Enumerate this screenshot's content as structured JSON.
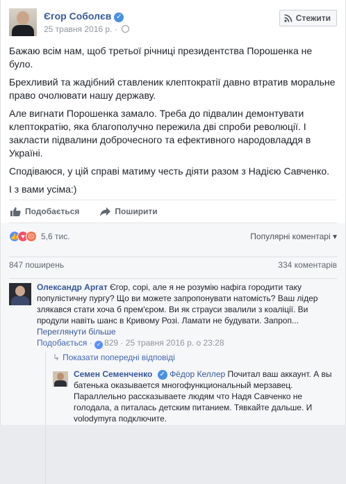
{
  "post": {
    "author": "Єгор Соболєв",
    "verified_mark": "✓",
    "date": "25 травня 2016 р.",
    "follow_label": "Стежити",
    "paragraphs": [
      "Бажаю всім нам, щоб третьої річниці президентства Порошенка не було.",
      "Брехливий та жадібний ставленик клептократії давно втратив моральне право очолювати нашу державу.",
      "Але вигнати Порошенка замало. Треба до підвалин демонтувати клептократію, яка благополучно пережила дві спроби революції. І закласти підвалини доброчесного та ефективного народовладдя в Україні.",
      "Сподіваюся, у цій справі матиму честь діяти разом з Надією Савченко.",
      "І з вами усіма:)"
    ]
  },
  "actions": {
    "like_label": "Подобається",
    "share_label": "Поширити"
  },
  "stats": {
    "reactions_count": "5,6 тис.",
    "sort_label": "Популярні коментарі",
    "shares": "847 поширень",
    "comments": "334 коментарів"
  },
  "comment": {
    "author": "Олександр Аргат",
    "text": "Єгор, сорі, але я не розумію нафіга городити таку популістичну пургу? Що ви можете запропонувати натомість? Ваш лідер злякався стати хоча б прем'єром. Ви як страуси звалили з коаліції. Ви продули навіть шанс в Кривому Розі. Ламати не будувати. Запроп...",
    "see_more": "Переглянути більше",
    "like_label": "Подобається",
    "like_count": "829",
    "separator": "·",
    "timestamp": "25 травня 2016 р. о 23:28",
    "prev_replies": "Показати попередні відповіді"
  },
  "reply": {
    "author": "Семен Семенченко",
    "tagged": "Фёдор Келлер",
    "text": "Почитал ваш аккаунт. А вы батенька оказывается многофункциональный мерзавец. Параллельно рассказываете людям что Надя Савченко не голодала, а питалась детским питанием. Тявкайте дальше. И volodymyra подключите."
  },
  "colors": {
    "link": "#365899",
    "like_blue": "#5890ff",
    "love_red": "#f25268",
    "angry_orange": "#f7714c"
  }
}
